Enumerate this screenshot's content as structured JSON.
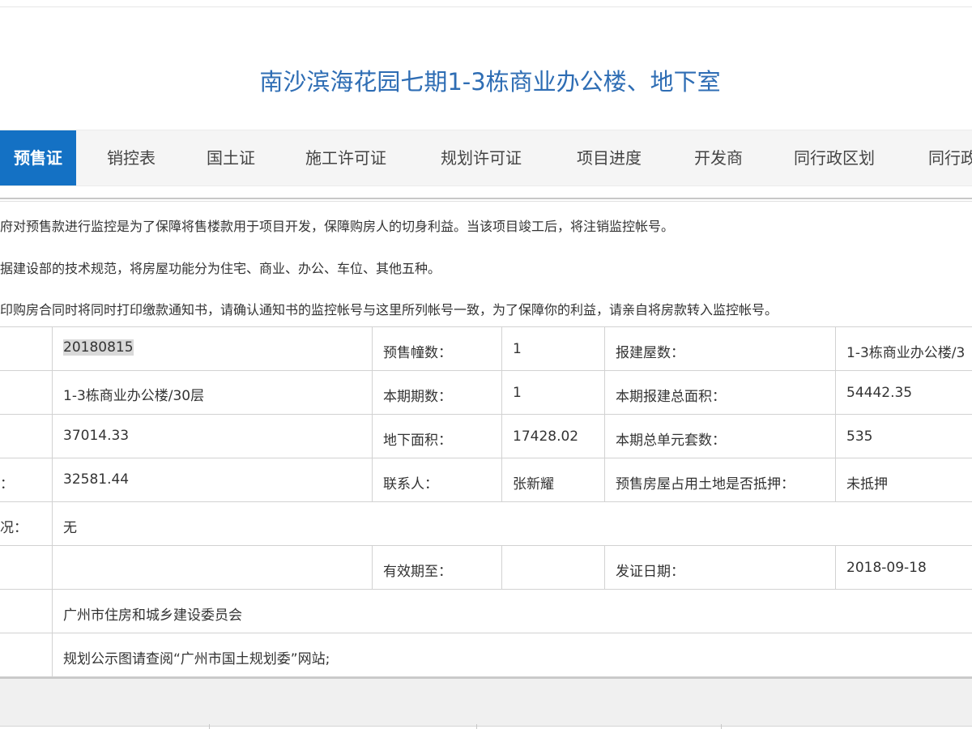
{
  "page": {
    "title": "南沙滨海花园七期1-3栋商业办公楼、地下室"
  },
  "tabs": [
    {
      "label": "预售证",
      "active": true
    },
    {
      "label": "销控表"
    },
    {
      "label": "国土证"
    },
    {
      "label": "施工许可证"
    },
    {
      "label": "规划许可证"
    },
    {
      "label": "项目进度"
    },
    {
      "label": "开发商"
    },
    {
      "label": "同行政区划"
    },
    {
      "label": "同行政"
    }
  ],
  "notes": [
    "府对预售款进行监控是为了保障将售楼款用于项目开发，保障购房人的切身利益。当该项目竣工后，将注销监控帐号。",
    "据建设部的技术规范，将房屋功能分为住宅、商业、办公、车位、其他五种。",
    "印购房合同时将同时打印缴款通知书，请确认通知书的监控帐号与这里所列帐号一致，为了保障你的利益，请亲自将房款转入监控帐号。"
  ],
  "table": {
    "rows": [
      {
        "c0": "",
        "c1": "20180815",
        "c2": "预售幢数：",
        "c3": "1",
        "c4": "报建屋数：",
        "c5": "1-3栋商业办公楼/3"
      },
      {
        "c0": "",
        "c1": "1-3栋商业办公楼/30层",
        "c2": "本期期数：",
        "c3": "1",
        "c4": "本期报建总面积：",
        "c5": "54442.35"
      },
      {
        "c0": "",
        "c1": "37014.33",
        "c2": "地下面积：",
        "c3": "17428.02",
        "c4": "本期总单元套数：",
        "c5": "535"
      },
      {
        "c0": "：",
        "c1": "32581.44",
        "c2": "联系人：",
        "c3": "张新耀",
        "c4": "预售房屋占用土地是否抵押：",
        "c5": "未抵押"
      },
      {
        "c0": "况：",
        "c1": "无"
      },
      {
        "c0": "",
        "c1": "",
        "c2": "有效期至：",
        "c3": "",
        "c4": "发证日期：",
        "c5": "2018-09-18"
      },
      {
        "c0": "",
        "c1": "广州市住房和城乡建设委员会"
      },
      {
        "c0": "",
        "c1": "规划公示图请查阅“广州市国土规划委”网站;"
      }
    ]
  }
}
